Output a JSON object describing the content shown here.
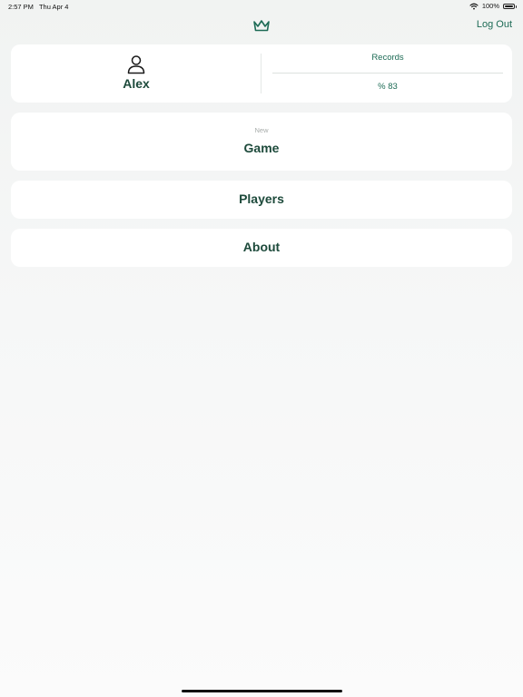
{
  "status_bar": {
    "time": "2:57 PM",
    "date": "Thu Apr 4",
    "battery": "100%",
    "battery_level": 1.0
  },
  "nav": {
    "logo_icon": "crown-icon",
    "logout_label": "Log Out"
  },
  "profile": {
    "avatar_icon": "person-icon",
    "name": "Alex",
    "records_label": "Records",
    "records_value": "% 83"
  },
  "menu": {
    "game_subtitle": "New",
    "game_label": "Game",
    "players_label": "Players",
    "about_label": "About"
  },
  "colors": {
    "accent": "#1d6b55",
    "text_dark": "#1d4a3b",
    "card": "#ffffff",
    "background": "#f3f5f4"
  }
}
